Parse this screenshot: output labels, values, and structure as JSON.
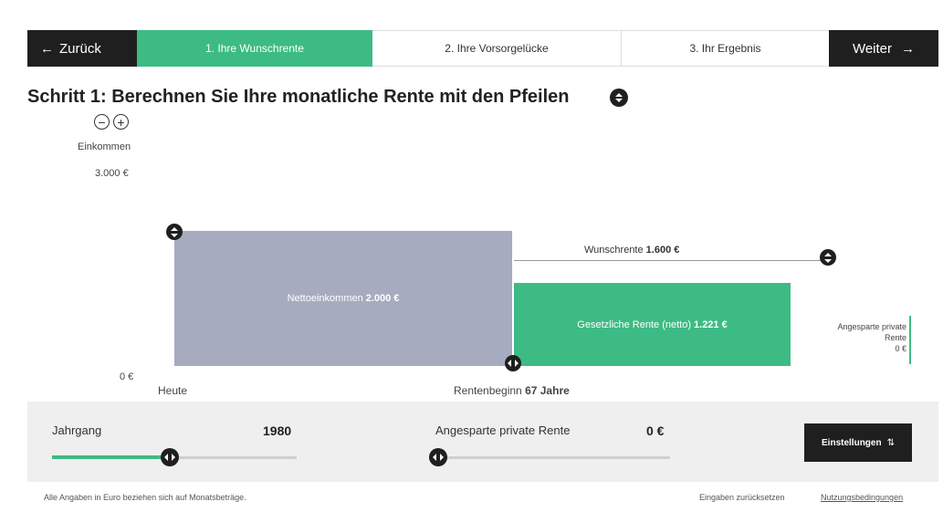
{
  "nav": {
    "back_arrow": "←",
    "back_label": "Zurück",
    "tabs": [
      {
        "label": "1. Ihre Wunschrente"
      },
      {
        "label": "2. Ihre Vorsorgelücke"
      },
      {
        "label": "3. Ihr Ergebnis"
      }
    ],
    "next_label": "Weiter",
    "next_arrow": "→"
  },
  "page": {
    "title": "Schritt 1: Berechnen Sie Ihre monatliche Rente mit den Pfeilen"
  },
  "chart": {
    "zoom_out": "−",
    "zoom_in": "+",
    "y_label": "Einkommen",
    "y_max": "3.000 €",
    "y_min": "0 €",
    "x_start": "Heute",
    "x_end_prefix": "Rentenbeginn",
    "x_end_value": "67 Jahre",
    "net_label": "Nettoeinkommen",
    "net_value": "2.000 €",
    "gov_label": "Gesetzliche Rente (netto)",
    "gov_value": "1.221 €",
    "wish_label": "Wunschrente",
    "wish_value": "1.600 €",
    "private_line1": "Angesparte private",
    "private_line2": "Rente",
    "private_value": "0 €"
  },
  "controls": {
    "year_label": "Jahrgang",
    "year_value": "1980",
    "year_slider_fraction": 0.48,
    "private_label": "Angesparte private Rente",
    "private_value": "0 €",
    "private_slider_fraction": 0.0,
    "settings_label": "Einstellungen",
    "settings_icon": "⇅"
  },
  "footer": {
    "note": "Alle Angaben in Euro beziehen sich auf Monatsbeträge.",
    "reset": "Eingaben zurücksetzen",
    "terms": "Nutzungsbedingungen"
  },
  "colors": {
    "accent_green": "#3dbb84",
    "dark": "#1f1f1f",
    "net_bar": "#a6abc0"
  }
}
